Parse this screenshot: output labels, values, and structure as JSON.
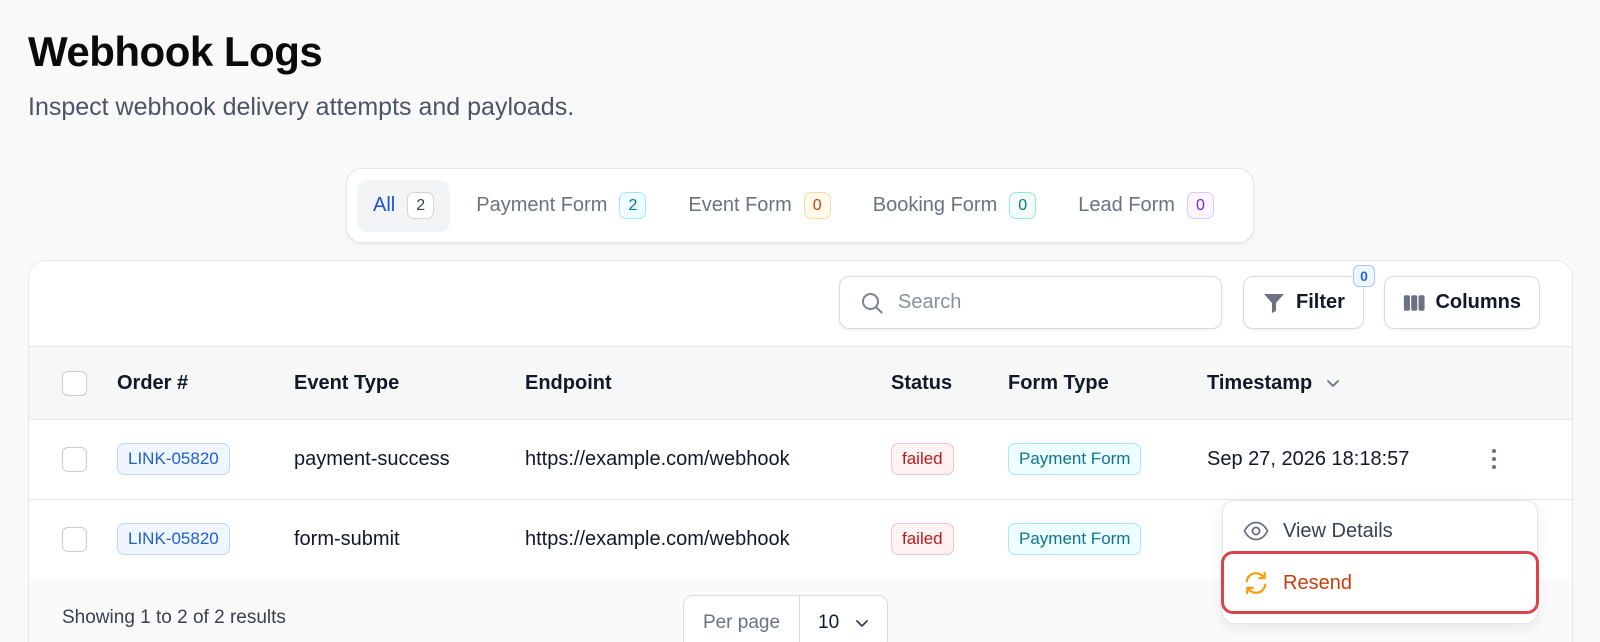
{
  "header": {
    "title": "Webhook Logs",
    "subtitle": "Inspect webhook delivery attempts and payloads."
  },
  "tabs": [
    {
      "label": "All",
      "count": "2",
      "active": true
    },
    {
      "label": "Payment Form",
      "count": "2"
    },
    {
      "label": "Event Form",
      "count": "0"
    },
    {
      "label": "Booking Form",
      "count": "0"
    },
    {
      "label": "Lead Form",
      "count": "0"
    }
  ],
  "toolbar": {
    "search_placeholder": "Search",
    "filter_label": "Filter",
    "filter_count": "0",
    "columns_label": "Columns"
  },
  "table": {
    "columns": [
      "Order #",
      "Event Type",
      "Endpoint",
      "Status",
      "Form Type",
      "Timestamp"
    ],
    "rows": [
      {
        "order": "LINK-05820",
        "event_type": "payment-success",
        "endpoint": "https://example.com/webhook",
        "status": "failed",
        "form_type": "Payment Form",
        "timestamp": "Sep 27, 2026 18:18:57"
      },
      {
        "order": "LINK-05820",
        "event_type": "form-submit",
        "endpoint": "https://example.com/webhook",
        "status": "failed",
        "form_type": "Payment Form",
        "timestamp": ""
      }
    ]
  },
  "footer": {
    "results_text": "Showing 1 to 2 of 2 results",
    "per_page_label": "Per page",
    "per_page_value": "10"
  },
  "row_menu": {
    "view_details": "View Details",
    "resend": "Resend"
  },
  "colors": {
    "accent": "#1d4ed8",
    "failed": "#b91c1c",
    "resend": "#c2410c",
    "highlight": "#d9434b"
  }
}
